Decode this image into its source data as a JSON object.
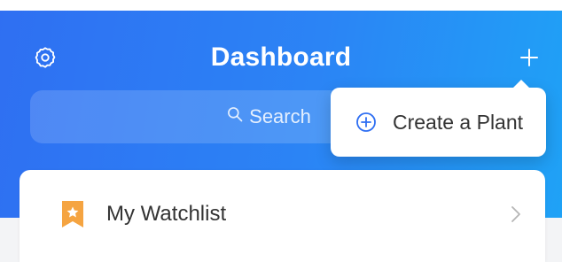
{
  "header": {
    "title": "Dashboard",
    "settings_icon": "gear-icon",
    "add_icon": "plus-icon"
  },
  "search": {
    "placeholder": "Search",
    "icon": "search-icon"
  },
  "popup_menu": {
    "items": [
      {
        "label": "Create a Plant",
        "icon": "plus-circle-icon"
      }
    ]
  },
  "watchlist": {
    "label": "My Watchlist",
    "icon": "star-bookmark-icon",
    "chevron": "chevron-right-icon"
  },
  "colors": {
    "header_gradient_start": "#2f6ff2",
    "header_gradient_end": "#1fa2f6",
    "accent": "#2f6ff2",
    "badge": "#f5a441",
    "text": "#333333",
    "background": "#f3f4f6"
  }
}
